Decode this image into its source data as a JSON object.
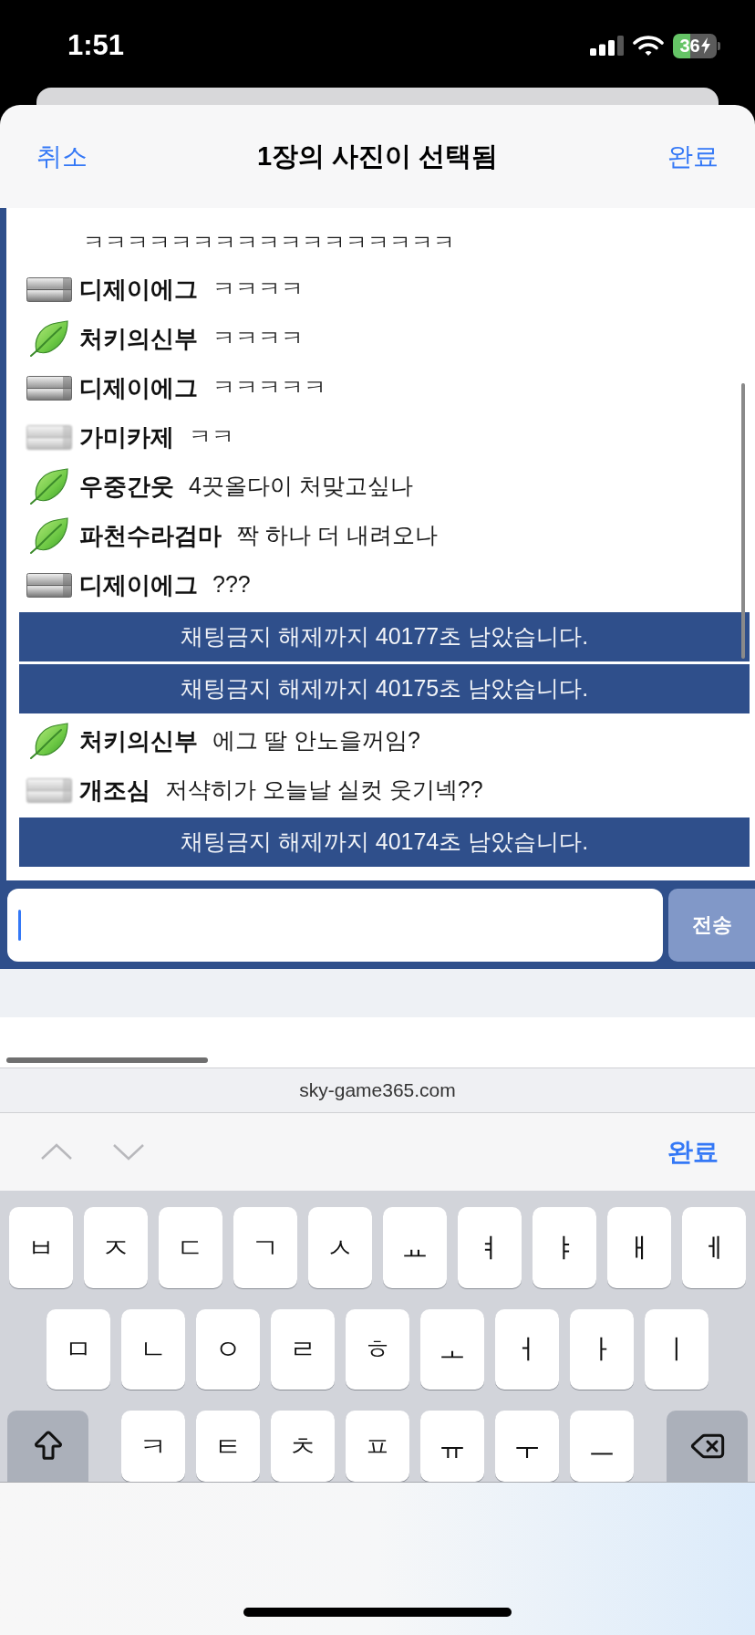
{
  "status_bar": {
    "time": "1:51",
    "battery": "36"
  },
  "sheet_header": {
    "cancel": "취소",
    "title": "1장의 사진이 선택됨",
    "done": "완료"
  },
  "chat": {
    "lines": [
      {
        "kind": "continuation",
        "text": "ㅋㅋㅋㅋㅋㅋㅋㅋㅋㅋㅋㅋㅋㅋㅋㅋㅋ"
      },
      {
        "kind": "message",
        "badge": {
          "kind": "bar",
          "faded": false
        },
        "user": "디제이에그",
        "text": "ㅋㅋㅋㅋ"
      },
      {
        "kind": "message",
        "badge": {
          "kind": "leaf",
          "faded": false
        },
        "user": "처키의신부",
        "text": "ㅋㅋㅋㅋ"
      },
      {
        "kind": "message",
        "badge": {
          "kind": "bar",
          "faded": false
        },
        "user": "디제이에그",
        "text": "ㅋㅋㅋㅋㅋ"
      },
      {
        "kind": "message",
        "badge": {
          "kind": "bar",
          "faded": true
        },
        "user": "가미카제",
        "text": "ㅋㅋ"
      },
      {
        "kind": "message",
        "badge": {
          "kind": "leaf",
          "faded": false
        },
        "user": "우중간웃",
        "text": "4끗올다이 처맞고싶나"
      },
      {
        "kind": "message",
        "badge": {
          "kind": "leaf",
          "faded": false
        },
        "user": "파천수라검마",
        "text": "짝 하나 더 내려오나"
      },
      {
        "kind": "message",
        "badge": {
          "kind": "bar",
          "faded": false
        },
        "user": "디제이에그",
        "text": "???"
      },
      {
        "kind": "notice",
        "text": "채팅금지 해제까지 40177초 남았습니다."
      },
      {
        "kind": "notice",
        "text": "채팅금지 해제까지 40175초 남았습니다."
      },
      {
        "kind": "message",
        "badge": {
          "kind": "leaf",
          "faded": false
        },
        "user": "처키의신부",
        "text": "에그 딸 안노을꺼임?"
      },
      {
        "kind": "message",
        "badge": {
          "kind": "bar",
          "faded": true
        },
        "user": "개조심",
        "text": "저샥히가 오늘날 실컷 웃기넥??"
      },
      {
        "kind": "notice",
        "text": "채팅금지 해제까지 40174초 남았습니다."
      }
    ]
  },
  "composer": {
    "focused": true,
    "send": "전송"
  },
  "browser": {
    "url": "sky-game365.com"
  },
  "keyboard_toolbar": {
    "arrows": [
      {
        "kind": "up",
        "disabled": true
      },
      {
        "kind": "down",
        "disabled": true
      }
    ],
    "done": "완료"
  },
  "keyboard": {
    "rows": [
      [
        {
          "kind": "letter",
          "label": "ㅂ"
        },
        {
          "kind": "letter",
          "label": "ㅈ"
        },
        {
          "kind": "letter",
          "label": "ㄷ"
        },
        {
          "kind": "letter",
          "label": "ㄱ"
        },
        {
          "kind": "letter",
          "label": "ㅅ"
        },
        {
          "kind": "letter",
          "label": "ㅛ"
        },
        {
          "kind": "letter",
          "label": "ㅕ"
        },
        {
          "kind": "letter",
          "label": "ㅑ"
        },
        {
          "kind": "letter",
          "label": "ㅐ"
        },
        {
          "kind": "letter",
          "label": "ㅔ"
        }
      ],
      [
        {
          "kind": "letter",
          "label": "ㅁ"
        },
        {
          "kind": "letter",
          "label": "ㄴ"
        },
        {
          "kind": "letter",
          "label": "ㅇ"
        },
        {
          "kind": "letter",
          "label": "ㄹ"
        },
        {
          "kind": "letter",
          "label": "ㅎ"
        },
        {
          "kind": "letter",
          "label": "ㅗ"
        },
        {
          "kind": "letter",
          "label": "ㅓ"
        },
        {
          "kind": "letter",
          "label": "ㅏ"
        },
        {
          "kind": "letter",
          "label": "ㅣ"
        }
      ],
      [
        {
          "kind": "shift"
        },
        {
          "kind": "letter",
          "label": "ㅋ"
        },
        {
          "kind": "letter",
          "label": "ㅌ"
        },
        {
          "kind": "letter",
          "label": "ㅊ"
        },
        {
          "kind": "letter",
          "label": "ㅍ"
        },
        {
          "kind": "letter",
          "label": "ㅠ"
        },
        {
          "kind": "letter",
          "label": "ㅜ"
        },
        {
          "kind": "letter",
          "label": "ㅡ"
        },
        {
          "kind": "backspace"
        }
      ]
    ]
  }
}
